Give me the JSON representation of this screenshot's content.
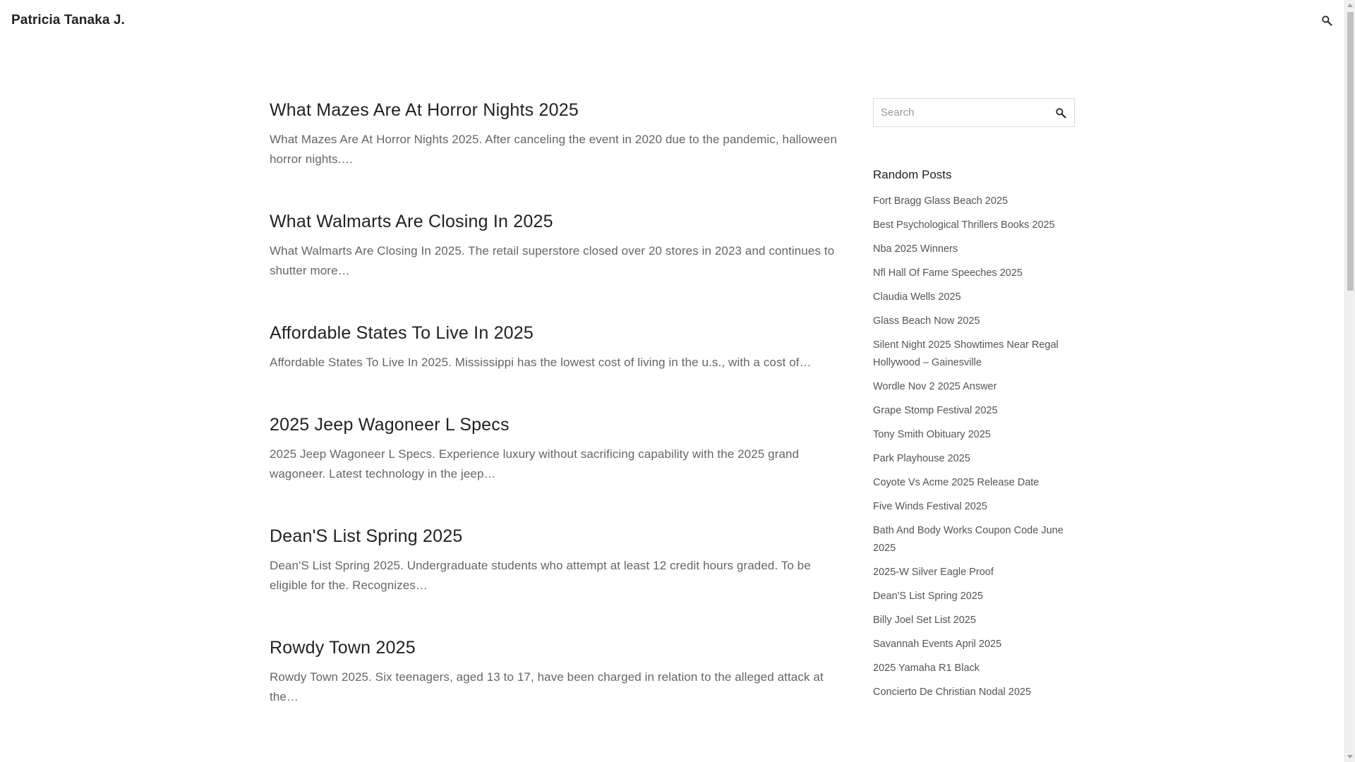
{
  "site": {
    "title": "Patricia Tanaka J."
  },
  "header": {
    "search_icon": "search-icon"
  },
  "posts": [
    {
      "title": "What Mazes Are At Horror Nights 2025",
      "excerpt": "What Mazes Are At Horror Nights 2025. After canceling the event in 2020 due to the pandemic, halloween horror nights.…"
    },
    {
      "title": "What Walmarts Are Closing In 2025",
      "excerpt": "What Walmarts Are Closing In 2025. The retail superstore closed over 20 stores in 2023 and continues to shutter more…"
    },
    {
      "title": "Affordable States To Live In 2025",
      "excerpt": "Affordable States To Live In 2025. Mississippi has the lowest cost of living in the u.s., with a cost of…"
    },
    {
      "title": "2025 Jeep Wagoneer L Specs",
      "excerpt": "2025 Jeep Wagoneer L Specs. Experience luxury without sacrificing capability with the 2025 grand wagoneer. Latest technology in the jeep…"
    },
    {
      "title": "Dean'S List Spring 2025",
      "excerpt": "Dean'S List Spring 2025. Undergraduate students who attempt at least 12 credit hours graded. To be eligible for the. Recognizes…"
    },
    {
      "title": "Rowdy Town 2025",
      "excerpt": "Rowdy Town 2025. Six teenagers, aged 13 to 17, have been charged in relation to the alleged attack at the…"
    }
  ],
  "sidebar": {
    "search": {
      "placeholder": "Search",
      "value": ""
    },
    "random_posts": {
      "title": "Random Posts",
      "items": [
        "Fort Bragg Glass Beach 2025",
        "Best Psychological Thrillers Books 2025",
        "Nba 2025 Winners",
        "Nfl Hall Of Fame Speeches 2025",
        "Claudia Wells 2025",
        "Glass Beach Now 2025",
        "Silent Night 2025 Showtimes Near Regal Hollywood – Gainesville",
        "Wordle Nov 2 2025 Answer",
        "Grape Stomp Festival 2025",
        "Tony Smith Obituary 2025",
        "Park Playhouse 2025",
        "Coyote Vs Acme 2025 Release Date",
        "Five Winds Festival 2025",
        "Bath And Body Works Coupon Code June 2025",
        "2025-W Silver Eagle Proof",
        "Dean'S List Spring 2025",
        "Billy Joel Set List 2025",
        "Savannah Events April 2025",
        "2025 Yamaha R1 Black",
        "Concierto De Christian Nodal 2025"
      ]
    }
  }
}
